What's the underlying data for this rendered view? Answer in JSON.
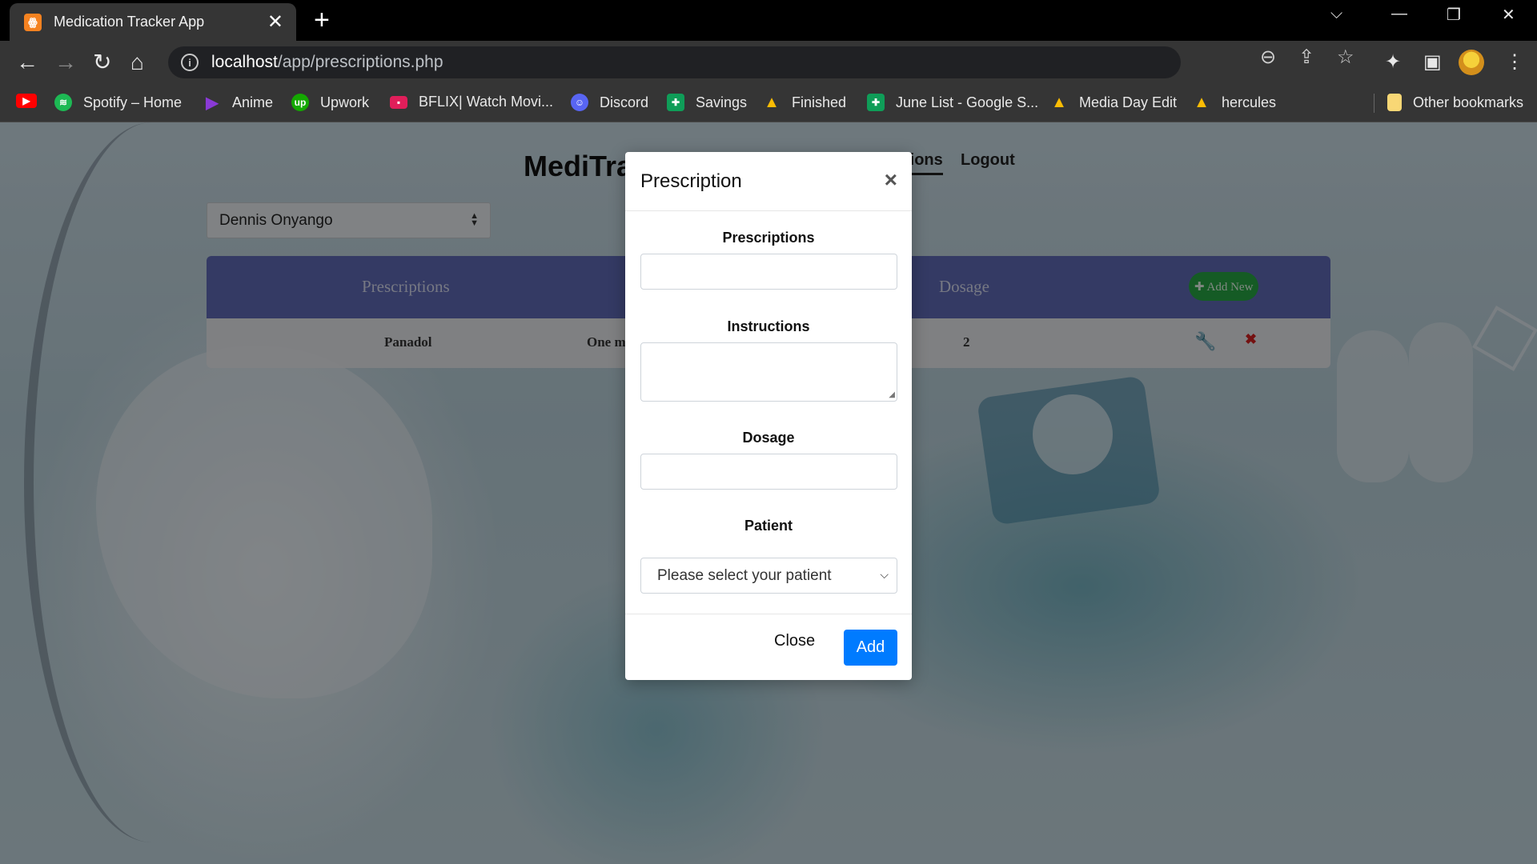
{
  "browser": {
    "tab_title": "Medication Tracker App",
    "tab_close": "✕",
    "new_tab": "+",
    "url_host": "localhost",
    "url_path": "/app/prescriptions.php",
    "bookmarks": [
      {
        "label": "",
        "icon": "youtube-icon",
        "color": "#ff0000"
      },
      {
        "label": "Spotify – Home",
        "icon": "spotify-icon",
        "color": "#1db954"
      },
      {
        "label": "Anime",
        "icon": "play-icon",
        "color": "#8a3ad6"
      },
      {
        "label": "Upwork",
        "icon": "upwork-icon",
        "color": "#14a800"
      },
      {
        "label": "BFLIX| Watch Movi...",
        "icon": "bflix-icon",
        "color": "#e01e5a"
      },
      {
        "label": "Discord",
        "icon": "discord-icon",
        "color": "#5865f2"
      },
      {
        "label": "Savings",
        "icon": "sheets-icon",
        "color": "#0f9d58"
      },
      {
        "label": "Finished",
        "icon": "drive-icon",
        "color": "#fbbc04"
      },
      {
        "label": "June List - Google S...",
        "icon": "sheets-icon",
        "color": "#0f9d58"
      },
      {
        "label": "Media Day Edit",
        "icon": "drive-icon",
        "color": "#fbbc04"
      },
      {
        "label": "hercules",
        "icon": "drive-icon",
        "color": "#fbbc04"
      }
    ],
    "other_bookmarks": "Other bookmarks"
  },
  "page": {
    "brand": "MediTra",
    "nav_active": "tions",
    "nav_logout": "Logout",
    "patient_selected": "Dennis Onyango",
    "table": {
      "col_prescriptions": "Prescriptions",
      "col_dosage": "Dosage",
      "add_new": "✚ Add New",
      "rows": [
        {
          "prescription": "Panadol",
          "instructions": "One m",
          "dosage": "2"
        }
      ]
    }
  },
  "modal": {
    "title": "Prescription",
    "close_x": "×",
    "label_prescriptions": "Prescriptions",
    "prescriptions_value": "",
    "label_instructions": "Instructions",
    "instructions_value": "",
    "label_dosage": "Dosage",
    "dosage_value": "",
    "label_patient": "Patient",
    "patient_placeholder": "Please select your patient",
    "btn_close": "Close",
    "btn_add": "Add"
  },
  "colors": {
    "table_header": "#5f6ab7",
    "add_new_button": "#27a744",
    "primary_button": "#007bff",
    "delete_icon": "#d42020"
  }
}
